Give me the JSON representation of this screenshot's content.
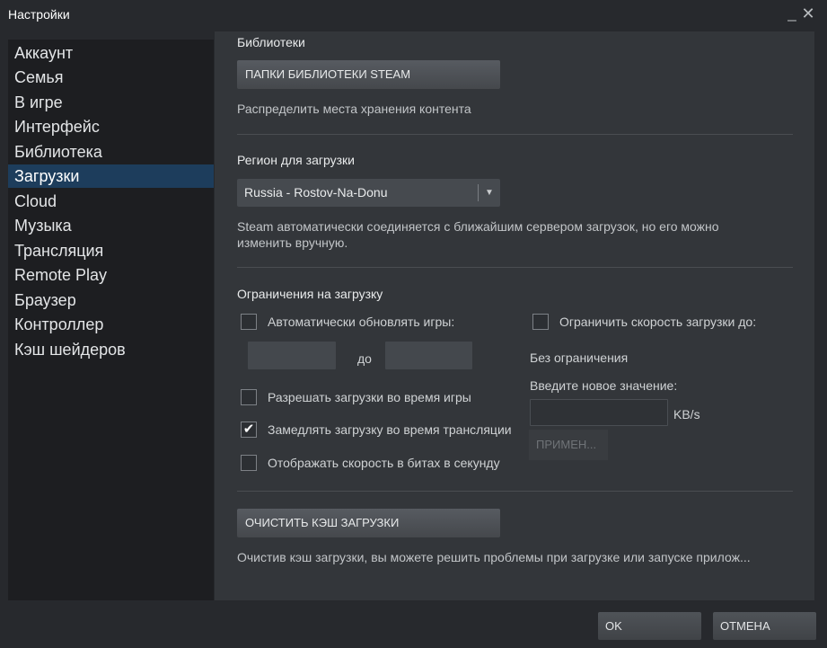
{
  "window": {
    "title": "Настройки",
    "minimize": "_",
    "close": "✕"
  },
  "sidebar": {
    "items": [
      {
        "label": "Аккаунт"
      },
      {
        "label": "Семья"
      },
      {
        "label": "В игре"
      },
      {
        "label": "Интерфейс"
      },
      {
        "label": "Библиотека"
      },
      {
        "label": "Загрузки",
        "active": true
      },
      {
        "label": "Cloud"
      },
      {
        "label": "Музыка"
      },
      {
        "label": "Трансляция"
      },
      {
        "label": "Remote Play"
      },
      {
        "label": "Браузер"
      },
      {
        "label": "Контроллер"
      },
      {
        "label": "Кэш шейдеров"
      }
    ]
  },
  "libraries": {
    "title": "Библиотеки",
    "button": "ПАПКИ БИБЛИОТЕКИ STEAM",
    "desc": "Распределить места хранения контента"
  },
  "region": {
    "title": "Регион для загрузки",
    "selected": "Russia - Rostov-Na-Donu",
    "arrow": "▼",
    "desc_line1": "Steam автоматически соединяется с ближайшим сервером загрузок, но его можно",
    "desc_line2": "изменить вручную."
  },
  "limits": {
    "title": "Ограничения на загрузку",
    "auto_update": {
      "label": "Автоматически обновлять игры:",
      "checked": false
    },
    "time_from": "",
    "time_sep": "до",
    "time_to": "",
    "allow_ingame": {
      "label": "Разрешать загрузки во время игры",
      "checked": false
    },
    "throttle_broadcast": {
      "label": "Замедлять загрузку во время трансляции",
      "checked": true
    },
    "show_bits": {
      "label": "Отображать скорость в битах в секунду",
      "checked": false
    },
    "limit_speed": {
      "label": "Ограничить скорость загрузки до:",
      "checked": false
    },
    "no_limit": "Без ограничения",
    "enter_value": "Введите новое значение:",
    "speed_value": "",
    "unit": "KB/s",
    "apply": "ПРИМЕН..."
  },
  "cache": {
    "button": "ОЧИСТИТЬ КЭШ ЗАГРУЗКИ",
    "desc": "Очистив кэш загрузки, вы можете решить проблемы при загрузке или запуске прилож..."
  },
  "footer": {
    "ok": "OK",
    "cancel": "ОТМЕНА"
  },
  "icons": {
    "check": "check-icon",
    "dropdown": "chevron-down-icon"
  },
  "colors": {
    "active_item": "#1d3d5c",
    "background": "#27292d",
    "panel": "#33363a"
  }
}
